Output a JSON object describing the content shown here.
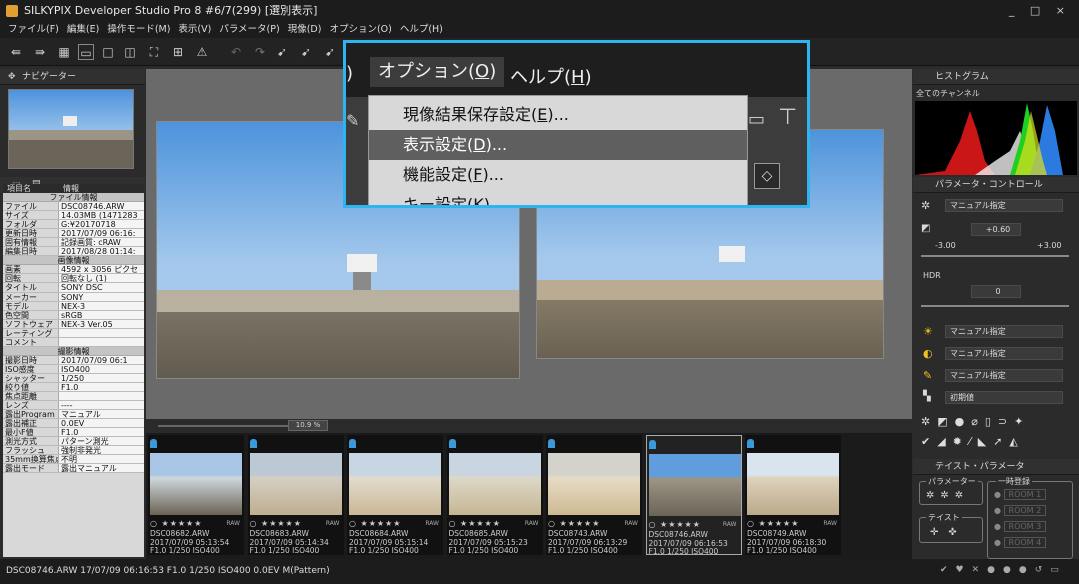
{
  "window": {
    "title": "SILKYPIX Developer Studio Pro 8   #6/7(299) [選別表示]",
    "controls": "_ □ ×"
  },
  "menu": [
    "ファイル(F)",
    "編集(E)",
    "操作モード(M)",
    "表示(V)",
    "パラメータ(P)",
    "現像(D)",
    "オプション(O)",
    "ヘルプ(H)"
  ],
  "left": {
    "navigator_title": "ナビゲーター",
    "info_header": {
      "col1": "項目名",
      "col2": "情報"
    },
    "file_section": "ファイル情報",
    "file_rows": [
      [
        "ファイル",
        "DSC08746.ARW"
      ],
      [
        "サイズ",
        "14.03MB (1471283"
      ],
      [
        "フォルダ",
        "G:¥20170718"
      ],
      [
        "更新日時",
        "2017/07/09 06:16:"
      ],
      [
        "固有情報",
        "記録画質: cRAW"
      ],
      [
        "編集日時",
        "2017/08/28 01:14:"
      ]
    ],
    "image_section": "画像情報",
    "image_rows": [
      [
        "画素",
        "4592 x 3056 ピクセ"
      ],
      [
        "回転",
        "回転なし (1)"
      ],
      [
        "タイトル",
        "SONY DSC"
      ],
      [
        "メーカー",
        "SONY"
      ],
      [
        "モデル",
        "NEX-3"
      ],
      [
        "色空間",
        "sRGB"
      ],
      [
        "ソフトウェア",
        "NEX-3 Ver.05"
      ],
      [
        "レーティング",
        ""
      ],
      [
        "コメント",
        ""
      ]
    ],
    "shoot_section": "撮影情報",
    "shoot_rows": [
      [
        "撮影日時",
        "2017/07/09 06:1"
      ],
      [
        "ISO感度",
        "ISO400"
      ],
      [
        "シャッター",
        "1/250"
      ],
      [
        "絞り値",
        "F1.0"
      ],
      [
        "焦点距離",
        ""
      ],
      [
        "レンズ",
        "----"
      ],
      [
        "露出Program",
        "マニュアル"
      ],
      [
        "露出補正",
        "0.0EV"
      ],
      [
        "最小F値",
        "F1.0"
      ],
      [
        "測光方式",
        "パターン測光"
      ],
      [
        "フラッシュ",
        "強制非発光"
      ],
      [
        "35mm換算焦点",
        "不明"
      ],
      [
        "露出モード",
        "露出マニュアル"
      ]
    ]
  },
  "viewer": {
    "zoom": "10.9 %"
  },
  "filmstrip": [
    {
      "name": "DSC08682.ARW",
      "date": "2017/07/09 05:13:54",
      "exif": "F1.0 1/250 ISO400",
      "raw": "RAW"
    },
    {
      "name": "DSC08683.ARW",
      "date": "2017/07/09 05:14:34",
      "exif": "F1.0 1/250 ISO400",
      "raw": "RAW"
    },
    {
      "name": "DSC08684.ARW",
      "date": "2017/07/09 05:15:14",
      "exif": "F1.0 1/250 ISO400",
      "raw": "RAW"
    },
    {
      "name": "DSC08685.ARW",
      "date": "2017/07/09 05:15:23",
      "exif": "F1.0 1/250 ISO400",
      "raw": "RAW"
    },
    {
      "name": "DSC08743.ARW",
      "date": "2017/07/09 06:13:29",
      "exif": "F1.0 1/250 ISO400",
      "raw": "RAW"
    },
    {
      "name": "DSC08746.ARW",
      "date": "2017/07/09 06:16:53",
      "exif": "F1.0 1/250 ISO400",
      "raw": "RAW"
    },
    {
      "name": "DSC08749.ARW",
      "date": "2017/07/09 06:18:30",
      "exif": "F1.0 1/250 ISO400",
      "raw": "RAW"
    }
  ],
  "right": {
    "histogram_title": "ヒストグラム",
    "channel": "全てのチャンネル",
    "param_title": "パラメータ・コントロール",
    "wb_mode": "マニュアル指定",
    "exposure_value": "+0.60",
    "exp_min": "-3.00",
    "exp_max": "+3.00",
    "hdr_label": "HDR",
    "hdr_value": "0",
    "tone": "マニュアル指定",
    "contrast": "マニュアル指定",
    "sharp": "マニュアル指定",
    "noise": "初期値",
    "taste_title": "テイスト・パラメータ",
    "param_group": "パラメーター",
    "taste_group": "テイスト",
    "temp_group": "一時登録",
    "rooms": [
      "ROOM 1",
      "ROOM 2",
      "ROOM 3",
      "ROOM 4"
    ]
  },
  "popup": {
    "bar_prev": ")",
    "bar_option": "オプション(",
    "bar_option_key": "O",
    "bar_help": "ヘルプ(",
    "bar_help_key": "H",
    "items": [
      {
        "pre": "現像結果保存設定(",
        "key": "E",
        "post": ")..."
      },
      {
        "pre": "表示設定(",
        "key": "D",
        "post": ")..."
      },
      {
        "pre": "機能設定(",
        "key": "F",
        "post": ")..."
      },
      {
        "pre": "キー設定(",
        "key": "K",
        "post": ")"
      }
    ]
  },
  "status": "DSC08746.ARW 17/07/09 06:16:53 F1.0 1/250 ISO400  0.0EV M(Pattern)"
}
